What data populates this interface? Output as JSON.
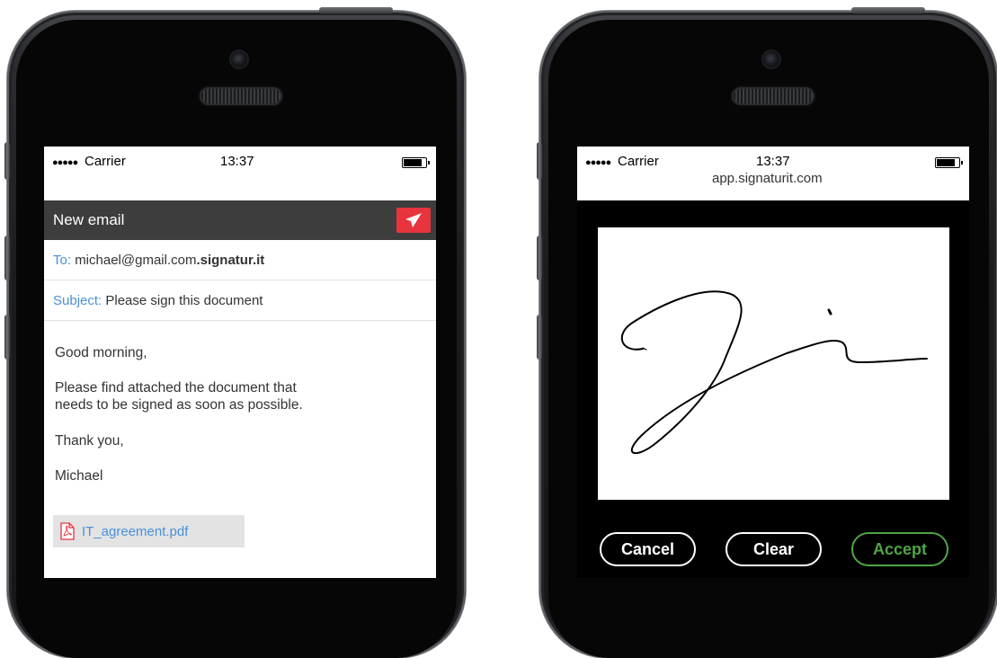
{
  "status_bar": {
    "signal": "●●●●●",
    "carrier": "Carrier",
    "time": "13:37"
  },
  "email": {
    "header_title": "New email",
    "send_icon": "paper-plane-icon",
    "to_label": "To:",
    "to_value": "michael@gmail.com",
    "to_suffix": ".signatur.it",
    "subject_label": "Subject:",
    "subject_value": "Please sign this document",
    "greeting": "Good morning,",
    "body_line1": "Please find attached the document that",
    "body_line2": "needs to be signed as soon as possible.",
    "thanks": "Thank you,",
    "signature_name": "Michael",
    "attachment_icon": "pdf-icon",
    "attachment_name": "IT_agreement.pdf"
  },
  "signing": {
    "url": "app.signaturit.com",
    "cancel_label": "Cancel",
    "clear_label": "Clear",
    "accept_label": "Accept"
  },
  "colors": {
    "nav_bar": "#3d3d3d",
    "send_button": "#e8343d",
    "link_blue": "#4a90d9",
    "accept_green": "#4fa447"
  }
}
